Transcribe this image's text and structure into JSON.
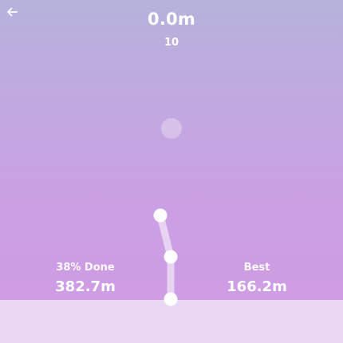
{
  "hud": {
    "distance": "0.0m",
    "counter": "10"
  },
  "progress": {
    "label": "38% Done",
    "value": "382.7m",
    "percent": 38
  },
  "best": {
    "label": "Best",
    "value": "166.2m"
  },
  "icons": {
    "back": "back-arrow-icon"
  },
  "colors": {
    "sky_top": "#b6b2dc",
    "sky_bottom": "#cf9ce4",
    "ground": "#ead8f2",
    "joint": "#ffffff"
  }
}
